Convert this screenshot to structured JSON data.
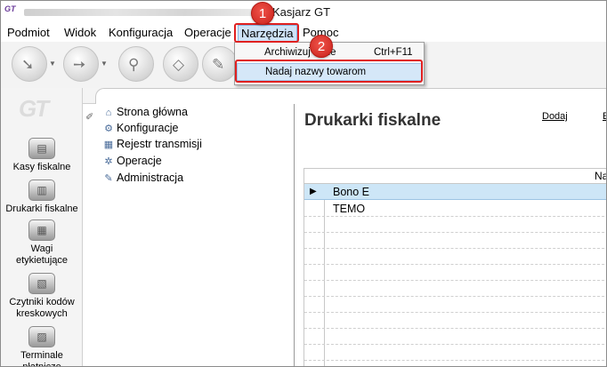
{
  "window": {
    "app_icon": "GT",
    "title_suffix": "Kasjarz GT"
  },
  "menubar": {
    "items": [
      "Podmiot",
      "Widok",
      "Konfiguracja",
      "Operacje",
      "Narzędzia",
      "Pomoc"
    ],
    "active": "Narzędzia"
  },
  "dropdown": {
    "items": [
      {
        "label": "Archiwizuj dane",
        "shortcut": "Ctrl+F11"
      },
      {
        "label": "Nadaj nazwy towarom",
        "shortcut": ""
      }
    ]
  },
  "annotations": {
    "step1": "1",
    "step2": "2",
    "highlight_color": "#e02020"
  },
  "sidebar": {
    "logo": "GT",
    "items": [
      {
        "label": "Kasy fiskalne",
        "icon": "cash-register-icon"
      },
      {
        "label": "Drukarki fiskalne",
        "icon": "fiscal-printer-icon"
      },
      {
        "label": "Wagi etykietujące",
        "icon": "label-scale-icon"
      },
      {
        "label": "Czytniki kodów kreskowych",
        "icon": "barcode-scanner-icon"
      },
      {
        "label": "Terminale płatnicze",
        "icon": "payment-terminal-icon"
      }
    ]
  },
  "tree": {
    "items": [
      {
        "label": "Strona główna",
        "icon": "home-icon"
      },
      {
        "label": "Konfiguracje",
        "icon": "config-icon"
      },
      {
        "label": "Rejestr transmisji",
        "icon": "register-icon"
      },
      {
        "label": "Operacje",
        "icon": "operations-icon"
      },
      {
        "label": "Administracja",
        "icon": "admin-icon"
      }
    ]
  },
  "detail": {
    "title": "Drukarki fiskalne",
    "links": [
      "Dodaj",
      "E"
    ],
    "grid": {
      "header": "Na",
      "rows": [
        "Bono E",
        "TEMO"
      ],
      "selected_row": 0
    }
  }
}
